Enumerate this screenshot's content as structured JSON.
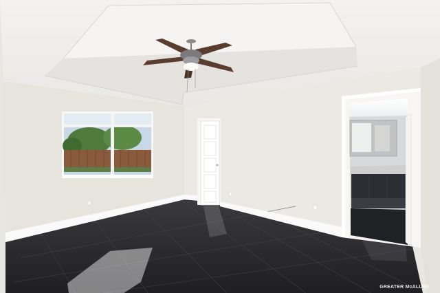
{
  "photo": {
    "subject": "empty-bedroom",
    "colors": {
      "ceiling": "#f1f0ee",
      "wall_left": "#e8e5df",
      "wall_back": "#ecebe7",
      "floor": "#2b2b2e",
      "trim": "#ffffff",
      "fan_blades": "#5a3d2e",
      "vanity": "#2c2e33"
    }
  },
  "watermark": {
    "text": "GREATER McALLEN"
  }
}
